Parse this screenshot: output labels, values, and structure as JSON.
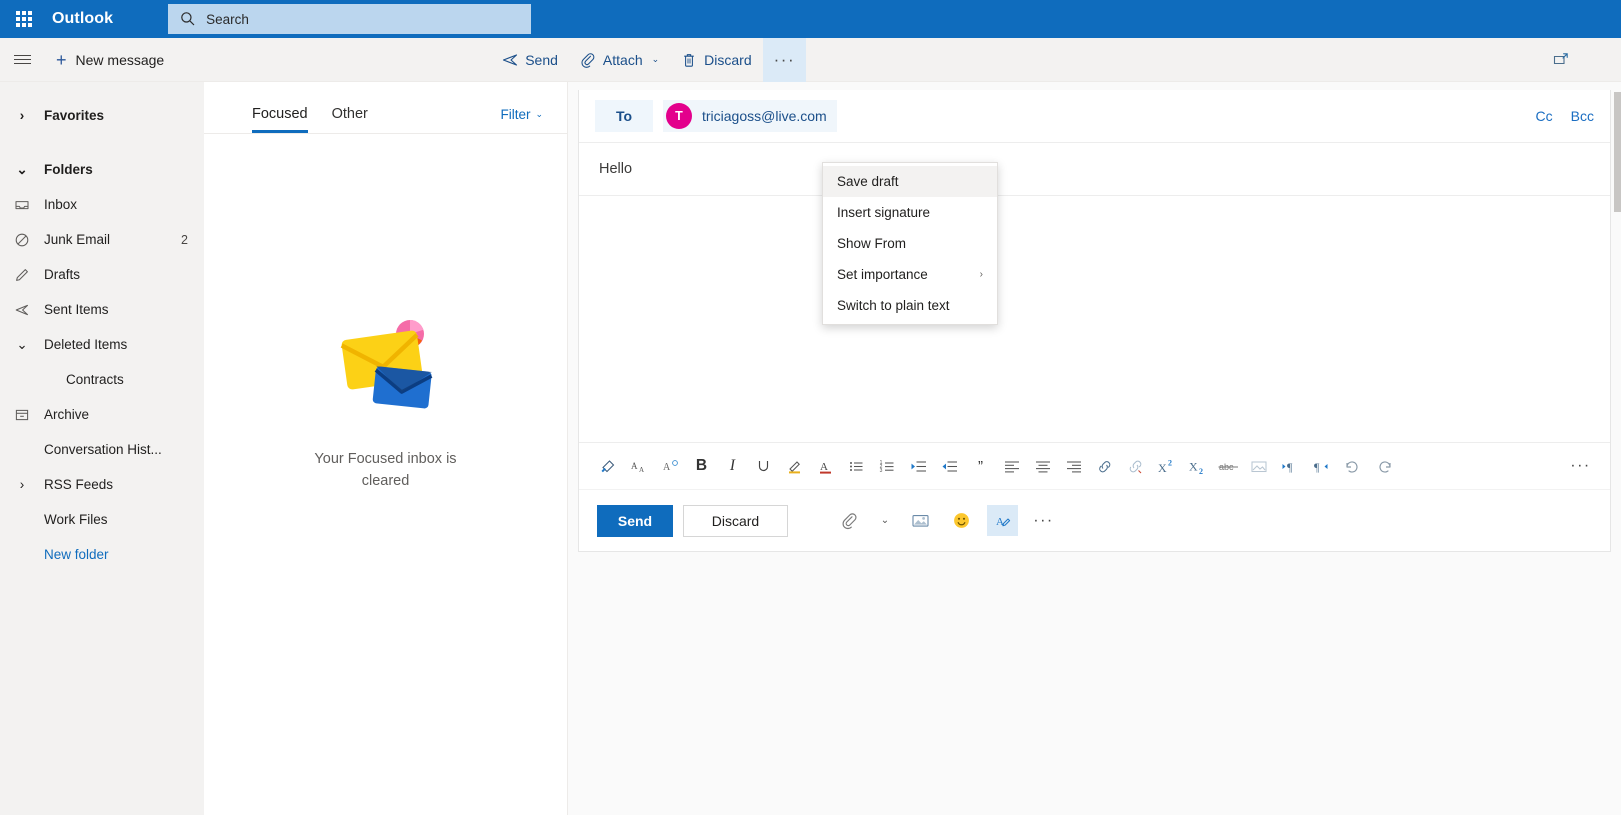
{
  "header": {
    "brand": "Outlook",
    "waffle_icon": "app-grid-icon",
    "search": {
      "placeholder": "Search",
      "icon": "search-icon"
    }
  },
  "command_bar": {
    "hamburger_icon": "hamburger-menu-icon",
    "new_message": {
      "label": "New message",
      "icon": "plus-icon"
    },
    "buttons": [
      {
        "label": "Send",
        "icon": "send-arrow-icon",
        "name": "send-command"
      },
      {
        "label": "Attach",
        "icon": "paperclip-icon",
        "name": "attach-command",
        "chevron": "⌄"
      },
      {
        "label": "Discard",
        "icon": "trash-icon",
        "name": "discard-command"
      },
      {
        "label": "···",
        "icon": "overflow-ellipsis-icon",
        "name": "more-commands-button"
      }
    ],
    "popout_icon": "popout-window-icon"
  },
  "sidebar": {
    "groups": [
      {
        "label": "Favorites",
        "twisty": "›",
        "type": "group",
        "name": "sidebar-group-favorites"
      },
      {
        "label": "Folders",
        "twisty": "⌄",
        "type": "group",
        "name": "sidebar-group-folders"
      }
    ],
    "folders": [
      {
        "label": "Inbox",
        "icon": "inbox-icon",
        "count": "",
        "name": "sidebar-item-inbox"
      },
      {
        "label": "Junk Email",
        "icon": "block-icon",
        "count": "2",
        "name": "sidebar-item-junk-email"
      },
      {
        "label": "Drafts",
        "icon": "pencil-icon",
        "count": "",
        "name": "sidebar-item-drafts"
      },
      {
        "label": "Sent Items",
        "icon": "sent-arrow-icon",
        "count": "",
        "name": "sidebar-item-sent-items"
      },
      {
        "label": "Deleted Items",
        "icon": "",
        "twisty": "⌄",
        "count": "",
        "name": "sidebar-item-deleted-items"
      },
      {
        "label": "Contracts",
        "icon": "",
        "indent": true,
        "count": "",
        "name": "sidebar-item-contracts"
      },
      {
        "label": "Archive",
        "icon": "archive-icon",
        "count": "",
        "name": "sidebar-item-archive"
      },
      {
        "label": "Conversation Hist...",
        "icon": "",
        "count": "",
        "name": "sidebar-item-conversation-history"
      },
      {
        "label": "RSS Feeds",
        "icon": "",
        "twisty": "›",
        "count": "",
        "name": "sidebar-item-rss-feeds"
      },
      {
        "label": "Work Files",
        "icon": "",
        "count": "",
        "name": "sidebar-item-work-files"
      },
      {
        "label": "New folder",
        "icon": "",
        "link": true,
        "count": "",
        "name": "sidebar-new-folder-link"
      }
    ]
  },
  "message_list": {
    "tabs": [
      {
        "label": "Focused",
        "selected": true
      },
      {
        "label": "Other",
        "selected": false
      }
    ],
    "filter": {
      "label": "Filter",
      "chevron": "⌄"
    },
    "empty_state": {
      "illustration": "empty-inbox-envelopes-illustration",
      "text": "Your Focused inbox is cleared"
    }
  },
  "compose": {
    "to": {
      "field_label": "To",
      "recipient_initial": "T",
      "recipient_address": "triciagoss@live.com",
      "avatar_color": "#e3008c"
    },
    "cc_label": "Cc",
    "bcc_label": "Bcc",
    "subject": "Hello",
    "body": "",
    "format_toolbar": [
      {
        "icon": "format-painter-icon",
        "name": "format-painter-button",
        "glyph": ""
      },
      {
        "icon": "font-size-icon",
        "name": "font-size-button",
        "glyph": ""
      },
      {
        "icon": "clear-formatting-icon",
        "name": "clear-formatting-button",
        "glyph": ""
      },
      {
        "icon": "bold-icon",
        "name": "bold-button",
        "glyph": "B"
      },
      {
        "icon": "italic-icon",
        "name": "italic-button",
        "glyph": "I"
      },
      {
        "icon": "underline-icon",
        "name": "underline-button",
        "glyph": "U"
      },
      {
        "icon": "highlight-icon",
        "name": "highlight-button",
        "glyph": ""
      },
      {
        "icon": "font-color-icon",
        "name": "font-color-button",
        "glyph": "A"
      },
      {
        "icon": "bulleted-list-icon",
        "name": "bulleted-list-button",
        "glyph": ""
      },
      {
        "icon": "numbered-list-icon",
        "name": "numbered-list-button",
        "glyph": ""
      },
      {
        "icon": "decrease-indent-icon",
        "name": "decrease-indent-button",
        "glyph": ""
      },
      {
        "icon": "increase-indent-icon",
        "name": "increase-indent-button",
        "glyph": ""
      },
      {
        "icon": "quote-icon",
        "name": "quote-button",
        "glyph": "”"
      },
      {
        "icon": "align-left-icon",
        "name": "align-left-button",
        "glyph": ""
      },
      {
        "icon": "align-center-icon",
        "name": "align-center-button",
        "glyph": ""
      },
      {
        "icon": "align-right-icon",
        "name": "align-right-button",
        "glyph": ""
      },
      {
        "icon": "insert-link-icon",
        "name": "insert-link-button",
        "glyph": ""
      },
      {
        "icon": "remove-link-icon",
        "name": "remove-link-button",
        "glyph": ""
      },
      {
        "icon": "superscript-icon",
        "name": "superscript-button",
        "glyph": ""
      },
      {
        "icon": "subscript-icon",
        "name": "subscript-button",
        "glyph": ""
      },
      {
        "icon": "strikethrough-icon",
        "name": "strikethrough-button",
        "glyph": "abc"
      },
      {
        "icon": "insert-picture-icon",
        "name": "insert-picture-button",
        "glyph": ""
      },
      {
        "icon": "left-to-right-icon",
        "name": "ltr-direction-button",
        "glyph": ""
      },
      {
        "icon": "right-to-left-icon",
        "name": "rtl-direction-button",
        "glyph": ""
      },
      {
        "icon": "undo-icon",
        "name": "undo-button",
        "glyph": ""
      },
      {
        "icon": "redo-icon",
        "name": "redo-button",
        "glyph": ""
      },
      {
        "icon": "more-formatting-icon",
        "name": "more-formatting-button",
        "glyph": "···"
      }
    ],
    "actions": {
      "send_label": "Send",
      "discard_label": "Discard",
      "attach_icon": "paperclip-icon",
      "attach_chevron": "⌄",
      "picture_icon": "picture-icon",
      "emoji_icon": "emoji-smiley-icon",
      "signature_icon": "signature-pen-icon",
      "more_icon": "more-options-icon",
      "more_glyph": "···"
    }
  },
  "context_menu": {
    "items": [
      {
        "label": "Save draft",
        "name": "menu-item-save-draft",
        "highlighted": true,
        "submenu": false
      },
      {
        "label": "Insert signature",
        "name": "menu-item-insert-signature",
        "highlighted": false,
        "submenu": false
      },
      {
        "label": "Show From",
        "name": "menu-item-show-from",
        "highlighted": false,
        "submenu": false
      },
      {
        "label": "Set importance",
        "name": "menu-item-set-importance",
        "highlighted": false,
        "submenu": true,
        "chevron": "›"
      },
      {
        "label": "Switch to plain text",
        "name": "menu-item-switch-to-plain-text",
        "highlighted": false,
        "submenu": false
      }
    ]
  },
  "colors": {
    "brand_blue": "#0f6cbd",
    "search_bg": "#bbd6ee",
    "chrome_gray": "#f3f2f1",
    "accent_pink": "#e3008c"
  }
}
